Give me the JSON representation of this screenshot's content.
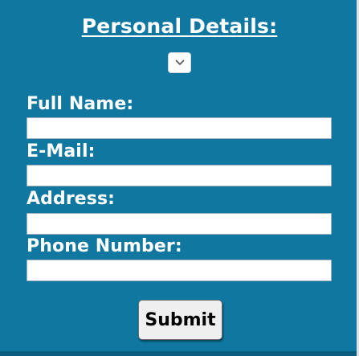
{
  "form": {
    "title": "Personal Details:",
    "toggle_icon": "chevron-down-icon",
    "fields": [
      {
        "label": "Full Name:",
        "value": "",
        "placeholder": ""
      },
      {
        "label": "E-Mail:",
        "value": "",
        "placeholder": ""
      },
      {
        "label": "Address:",
        "value": "",
        "placeholder": ""
      },
      {
        "label": "Phone Number:",
        "value": "",
        "placeholder": ""
      }
    ],
    "submit_label": "Submit"
  },
  "colors": {
    "panel_background": "#0f77a0",
    "text": "#ffffff",
    "button_background": "#efefef"
  }
}
